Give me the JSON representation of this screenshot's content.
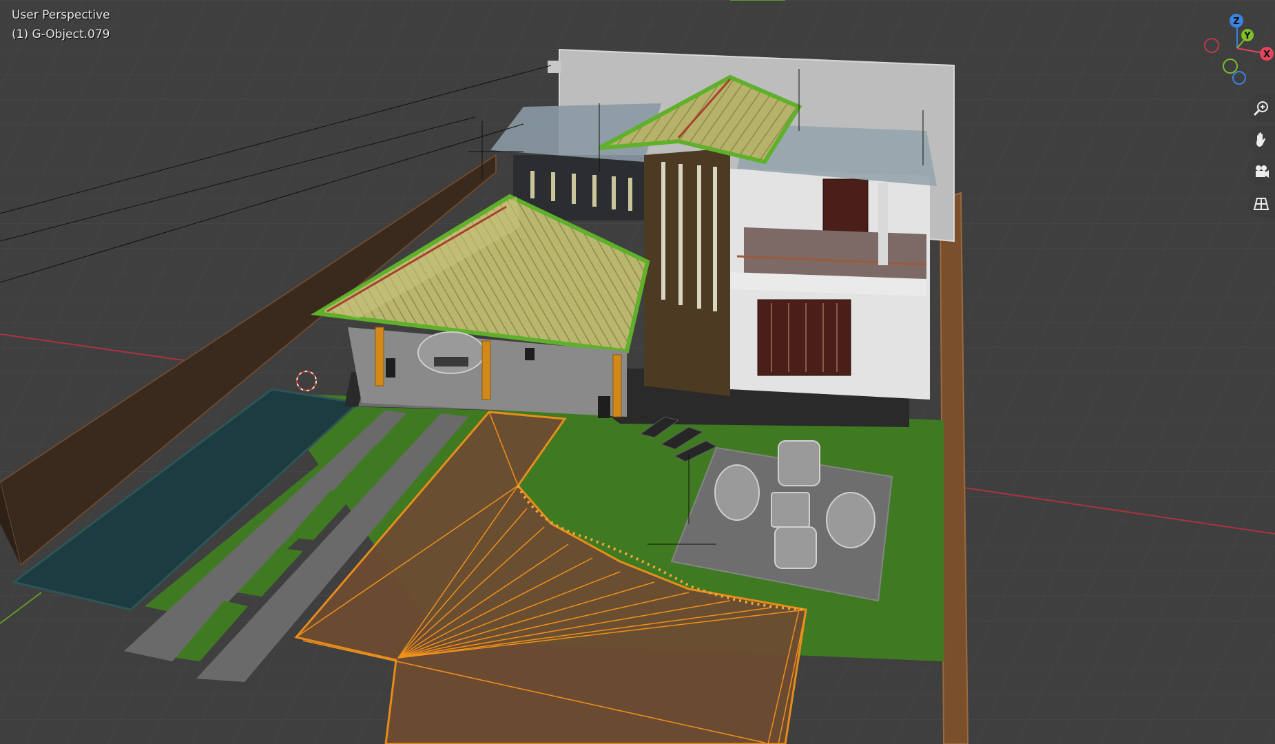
{
  "viewport": {
    "view_name": "User Perspective",
    "active_object": "(1) G-Object.079"
  },
  "gizmo": {
    "z_label": "Z",
    "y_label": "Y",
    "x_label": "X",
    "colors": {
      "x": "#e1455a",
      "y": "#7fbf2a",
      "z": "#3a83e0"
    }
  },
  "navigation": {
    "items": [
      {
        "name": "zoom",
        "icon": "zoom-icon"
      },
      {
        "name": "pan",
        "icon": "hand-icon"
      },
      {
        "name": "camera",
        "icon": "camera-icon"
      },
      {
        "name": "orthographic",
        "icon": "grid-icon"
      }
    ]
  },
  "colors": {
    "background": "#3f3f3f",
    "grid": "#4a4a4a",
    "x_axis": "#a8343e",
    "y_axis": "#5f9b2a",
    "selection": "#f0901a",
    "lawn": "#3f7a22",
    "roof": "#b8b36a",
    "pool": "#1d3c40",
    "wall": "#3a2a1e"
  }
}
